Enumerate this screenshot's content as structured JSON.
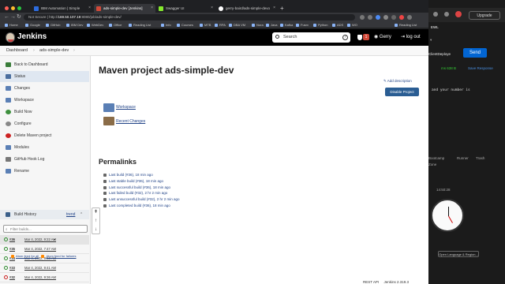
{
  "colors": {
    "jenkins_header": "#000000",
    "link": "#224488",
    "accent_button": "#2a5d93",
    "send_button": "#0265d2",
    "alert_badge": "#d24939"
  },
  "browser": {
    "tabs": [
      {
        "label": "IBM Automation | Simple",
        "favicon_color": "#2d6cdf"
      },
      {
        "label": "ads-simple-dev [Jenkins]",
        "favicon_color": "#d24939"
      },
      {
        "label": "Swagger UI",
        "favicon_color": "#85ea2d"
      },
      {
        "label": "gerry-baird/ads-simple-devo",
        "favicon_color": "#ffffff"
      }
    ],
    "new_tab": "+",
    "url_prefix": "Not Secure | http://",
    "url_host": "169.50.107.19",
    "url_path": ":8080/job/ads-simple-dev/",
    "bookmarks": [
      "Home",
      "Google",
      "GitHub",
      "IBM Dev",
      "WebDev",
      "Office",
      "Reading List",
      "Info",
      "Courses",
      "MTB",
      "RPA",
      "DBA VM",
      "Nora",
      "Java",
      "Kafka",
      "Fusrv",
      "Python",
      "ADS",
      "WO"
    ],
    "reading_list": "Reading List"
  },
  "jenkins": {
    "brand": "Jenkins",
    "search_placeholder": "Search",
    "help": "?",
    "alert_count": "1",
    "user": "Gerry",
    "logout": "log out",
    "breadcrumb": [
      "Dashboard",
      "ads-simple-dev"
    ],
    "sidebar": [
      {
        "label": "Back to Dashboard",
        "icon": "arrow-up-icon",
        "color": "#3a7d3a"
      },
      {
        "label": "Status",
        "icon": "search-icon",
        "color": "#4b6e9e"
      },
      {
        "label": "Changes",
        "icon": "notepad-icon",
        "color": "#5a7fb5"
      },
      {
        "label": "Workspace",
        "icon": "folder-icon",
        "color": "#5a7fb5"
      },
      {
        "label": "Build Now",
        "icon": "clock-icon",
        "color": "#3d8f3d"
      },
      {
        "label": "Configure",
        "icon": "gear-icon",
        "color": "#888888"
      },
      {
        "label": "Delete Maven project",
        "icon": "no-entry-icon",
        "color": "#cc2222"
      },
      {
        "label": "Modules",
        "icon": "modules-icon",
        "color": "#5a7fb5"
      },
      {
        "label": "GitHub Hook Log",
        "icon": "notepad-icon",
        "color": "#777777"
      },
      {
        "label": "Rename",
        "icon": "notepad-icon",
        "color": "#5a7fb5"
      }
    ],
    "build_history": {
      "title": "Build History",
      "trend": "trend",
      "filter_placeholder": "Filter builds...",
      "builds": [
        {
          "num": "#36",
          "date": "Mar 4, 2022, 9:22 AM",
          "status": "success"
        },
        {
          "num": "#35",
          "date": "Mar 4, 2022, 7:47 AM",
          "status": "success"
        },
        {
          "num": "#34",
          "date": "Mar 4, 2022, 9:53 AM",
          "status": "success"
        },
        {
          "num": "#33",
          "date": "Mar 4, 2022, 9:41 AM",
          "status": "success"
        },
        {
          "num": "#32",
          "date": "Mar 4, 2022, 9:36 AM",
          "status": "failed"
        }
      ],
      "atom_all": "Atom feed for all",
      "atom_failures": "Atom feed for failures"
    },
    "main": {
      "title": "Maven project ads-simple-dev",
      "add_description": "Add description",
      "disable_project": "Disable Project",
      "workspace": "Workspace",
      "recent_changes": "Recent Changes",
      "permalinks_title": "Permalinks",
      "permalinks": [
        "Last build (#36), 18 min ago",
        "Last stable build (#36), 18 min ago",
        "Last successful build (#36), 18 min ago",
        "Last failed build (#32), 2 hr 2 min ago",
        "Last unsuccessful build (#32), 2 hr 2 min ago",
        "Last completed build (#36), 18 min ago"
      ]
    },
    "footer": {
      "rest_api": "REST API",
      "version": "Jenkins 2.319.3"
    }
  },
  "side_app": {
    "upgrade": "Upgrade",
    "env": "EWL",
    "var_label": "ClientDeploye",
    "send": "Send",
    "status": "ms   638 B",
    "save_response": "Save Response",
    "body_snippet": "and your number is",
    "bootcamp": "Bootcamp",
    "runner": "Runner",
    "trash": "Trash",
    "zone": "Zone",
    "time": "14:50:28",
    "open_language": "Open Language & Region..."
  }
}
